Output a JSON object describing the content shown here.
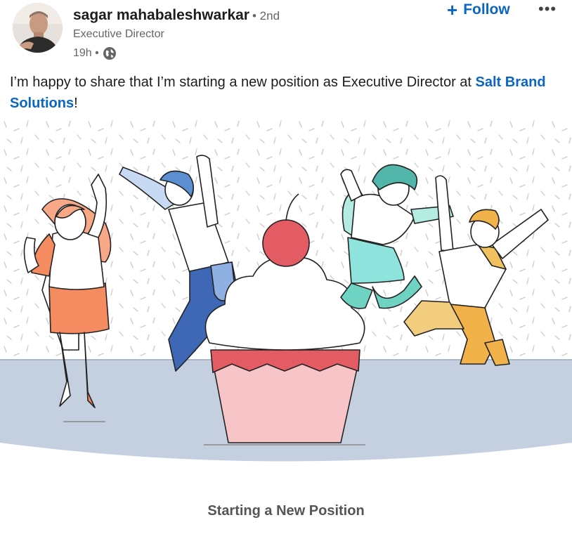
{
  "post": {
    "author": {
      "name": "sagar mahabaleshwarkar",
      "degree": "• 2nd",
      "headline": "Executive Director",
      "time": "19h •",
      "visibility_icon": "globe-icon"
    },
    "follow_label": "Follow",
    "more_icon": "more-options-icon",
    "text_before": "I’m happy to share that I’m starting a new position as Executive Director at ",
    "company_link": "Salt Brand Solutions",
    "text_after": "!",
    "image_caption": "Starting a New Position"
  },
  "colors": {
    "accent": "#0a66c2",
    "floor": "#c4cfe0",
    "cherry": "#e35b63",
    "cupcake_liner": "#f7c4c8",
    "frosting": "#ffffff"
  }
}
